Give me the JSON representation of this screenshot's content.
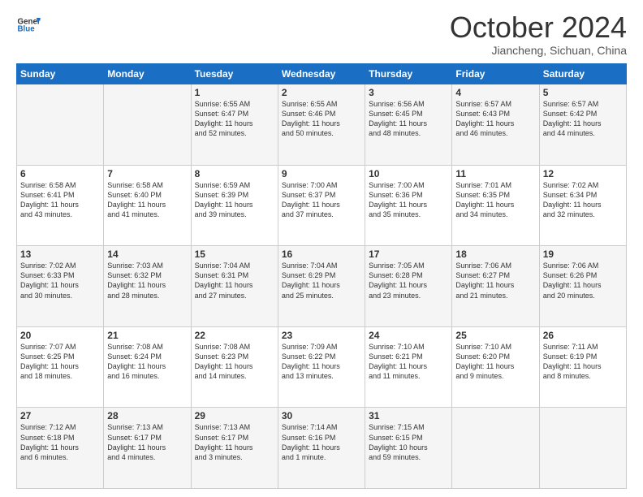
{
  "header": {
    "logo_line1": "General",
    "logo_line2": "Blue",
    "month": "October 2024",
    "location": "Jiancheng, Sichuan, China"
  },
  "weekdays": [
    "Sunday",
    "Monday",
    "Tuesday",
    "Wednesday",
    "Thursday",
    "Friday",
    "Saturday"
  ],
  "weeks": [
    [
      {
        "day": "",
        "info": ""
      },
      {
        "day": "",
        "info": ""
      },
      {
        "day": "1",
        "info": "Sunrise: 6:55 AM\nSunset: 6:47 PM\nDaylight: 11 hours\nand 52 minutes."
      },
      {
        "day": "2",
        "info": "Sunrise: 6:55 AM\nSunset: 6:46 PM\nDaylight: 11 hours\nand 50 minutes."
      },
      {
        "day": "3",
        "info": "Sunrise: 6:56 AM\nSunset: 6:45 PM\nDaylight: 11 hours\nand 48 minutes."
      },
      {
        "day": "4",
        "info": "Sunrise: 6:57 AM\nSunset: 6:43 PM\nDaylight: 11 hours\nand 46 minutes."
      },
      {
        "day": "5",
        "info": "Sunrise: 6:57 AM\nSunset: 6:42 PM\nDaylight: 11 hours\nand 44 minutes."
      }
    ],
    [
      {
        "day": "6",
        "info": "Sunrise: 6:58 AM\nSunset: 6:41 PM\nDaylight: 11 hours\nand 43 minutes."
      },
      {
        "day": "7",
        "info": "Sunrise: 6:58 AM\nSunset: 6:40 PM\nDaylight: 11 hours\nand 41 minutes."
      },
      {
        "day": "8",
        "info": "Sunrise: 6:59 AM\nSunset: 6:39 PM\nDaylight: 11 hours\nand 39 minutes."
      },
      {
        "day": "9",
        "info": "Sunrise: 7:00 AM\nSunset: 6:37 PM\nDaylight: 11 hours\nand 37 minutes."
      },
      {
        "day": "10",
        "info": "Sunrise: 7:00 AM\nSunset: 6:36 PM\nDaylight: 11 hours\nand 35 minutes."
      },
      {
        "day": "11",
        "info": "Sunrise: 7:01 AM\nSunset: 6:35 PM\nDaylight: 11 hours\nand 34 minutes."
      },
      {
        "day": "12",
        "info": "Sunrise: 7:02 AM\nSunset: 6:34 PM\nDaylight: 11 hours\nand 32 minutes."
      }
    ],
    [
      {
        "day": "13",
        "info": "Sunrise: 7:02 AM\nSunset: 6:33 PM\nDaylight: 11 hours\nand 30 minutes."
      },
      {
        "day": "14",
        "info": "Sunrise: 7:03 AM\nSunset: 6:32 PM\nDaylight: 11 hours\nand 28 minutes."
      },
      {
        "day": "15",
        "info": "Sunrise: 7:04 AM\nSunset: 6:31 PM\nDaylight: 11 hours\nand 27 minutes."
      },
      {
        "day": "16",
        "info": "Sunrise: 7:04 AM\nSunset: 6:29 PM\nDaylight: 11 hours\nand 25 minutes."
      },
      {
        "day": "17",
        "info": "Sunrise: 7:05 AM\nSunset: 6:28 PM\nDaylight: 11 hours\nand 23 minutes."
      },
      {
        "day": "18",
        "info": "Sunrise: 7:06 AM\nSunset: 6:27 PM\nDaylight: 11 hours\nand 21 minutes."
      },
      {
        "day": "19",
        "info": "Sunrise: 7:06 AM\nSunset: 6:26 PM\nDaylight: 11 hours\nand 20 minutes."
      }
    ],
    [
      {
        "day": "20",
        "info": "Sunrise: 7:07 AM\nSunset: 6:25 PM\nDaylight: 11 hours\nand 18 minutes."
      },
      {
        "day": "21",
        "info": "Sunrise: 7:08 AM\nSunset: 6:24 PM\nDaylight: 11 hours\nand 16 minutes."
      },
      {
        "day": "22",
        "info": "Sunrise: 7:08 AM\nSunset: 6:23 PM\nDaylight: 11 hours\nand 14 minutes."
      },
      {
        "day": "23",
        "info": "Sunrise: 7:09 AM\nSunset: 6:22 PM\nDaylight: 11 hours\nand 13 minutes."
      },
      {
        "day": "24",
        "info": "Sunrise: 7:10 AM\nSunset: 6:21 PM\nDaylight: 11 hours\nand 11 minutes."
      },
      {
        "day": "25",
        "info": "Sunrise: 7:10 AM\nSunset: 6:20 PM\nDaylight: 11 hours\nand 9 minutes."
      },
      {
        "day": "26",
        "info": "Sunrise: 7:11 AM\nSunset: 6:19 PM\nDaylight: 11 hours\nand 8 minutes."
      }
    ],
    [
      {
        "day": "27",
        "info": "Sunrise: 7:12 AM\nSunset: 6:18 PM\nDaylight: 11 hours\nand 6 minutes."
      },
      {
        "day": "28",
        "info": "Sunrise: 7:13 AM\nSunset: 6:17 PM\nDaylight: 11 hours\nand 4 minutes."
      },
      {
        "day": "29",
        "info": "Sunrise: 7:13 AM\nSunset: 6:17 PM\nDaylight: 11 hours\nand 3 minutes."
      },
      {
        "day": "30",
        "info": "Sunrise: 7:14 AM\nSunset: 6:16 PM\nDaylight: 11 hours\nand 1 minute."
      },
      {
        "day": "31",
        "info": "Sunrise: 7:15 AM\nSunset: 6:15 PM\nDaylight: 10 hours\nand 59 minutes."
      },
      {
        "day": "",
        "info": ""
      },
      {
        "day": "",
        "info": ""
      }
    ]
  ]
}
